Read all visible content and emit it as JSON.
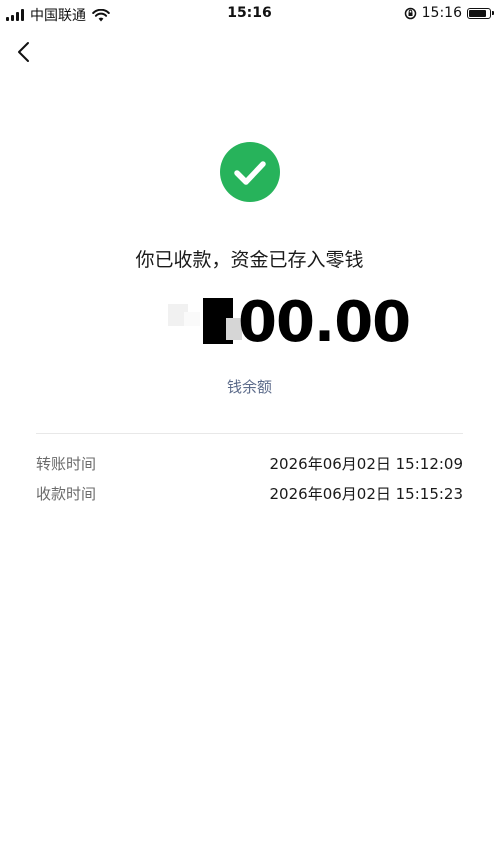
{
  "status_bar": {
    "carrier": "中国联通",
    "time": "15:16",
    "right_time": "15:16",
    "icons": [
      "signal-icon",
      "wifi-icon",
      "orientation-lock-icon",
      "battery-icon"
    ]
  },
  "navigation": {
    "back_icon": "chevron-left-icon"
  },
  "receipt": {
    "status_icon": "check-circle-icon",
    "status_color": "#27b35b",
    "title": "你已收款，资金已存入零钱",
    "amount_visible": "00.00",
    "balance_link": "钱余额",
    "balance_link_color": "#5c6b8a"
  },
  "details": [
    {
      "label": "转账时间",
      "value": "2026年06月02日 15:12:09"
    },
    {
      "label": "收款时间",
      "value": "2026年06月02日 15:15:23"
    }
  ]
}
